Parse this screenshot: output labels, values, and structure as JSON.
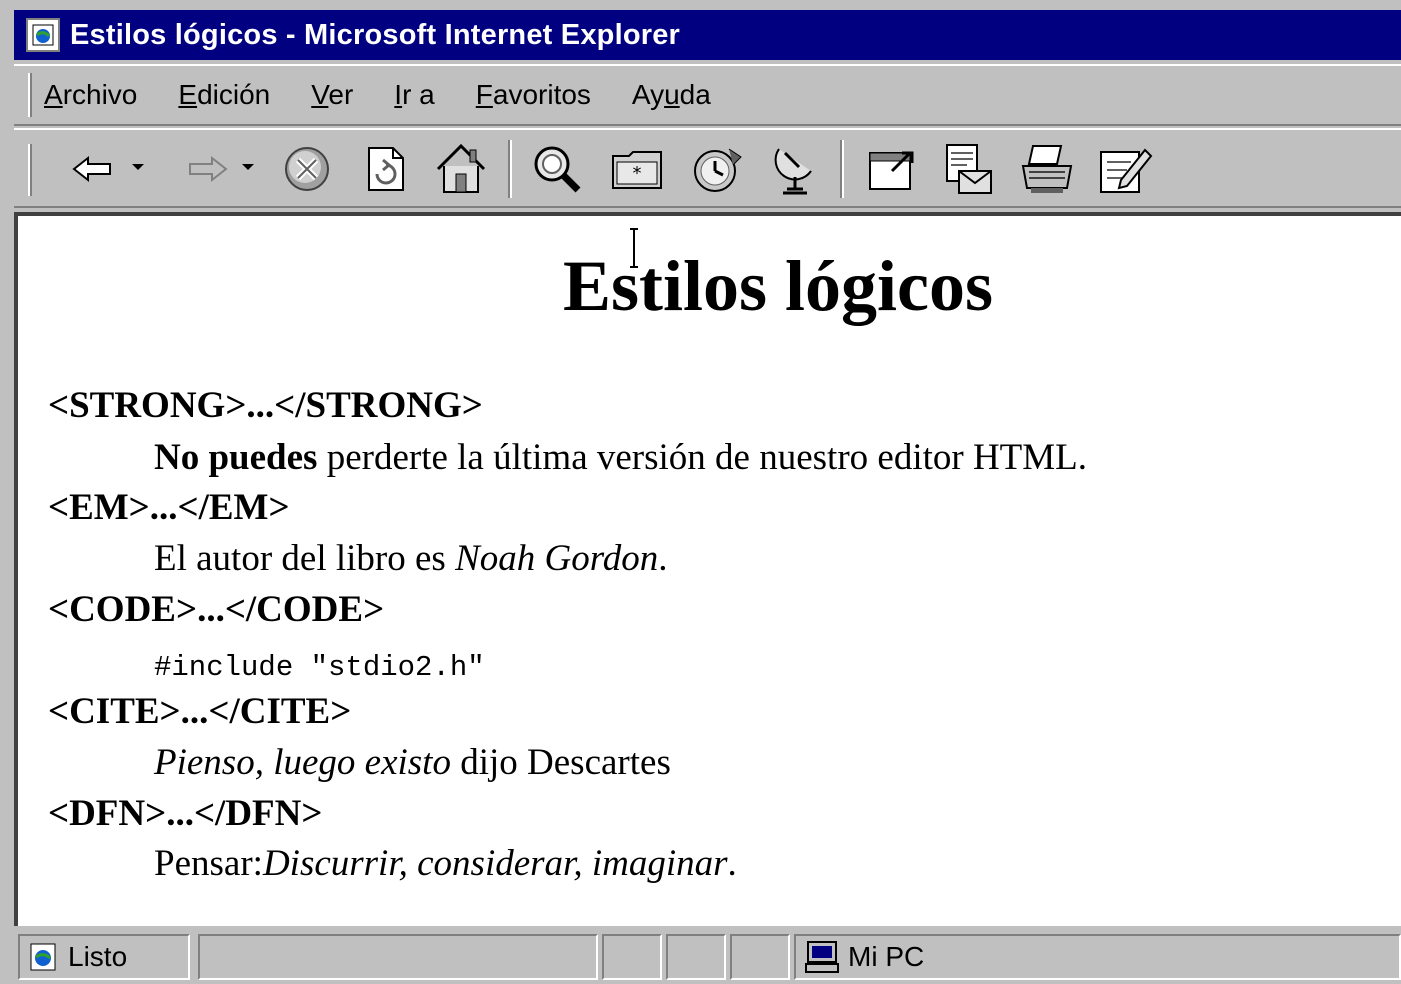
{
  "window": {
    "title": "Estilos lógicos - Microsoft Internet Explorer"
  },
  "menu": {
    "items": [
      {
        "label": "Archivo",
        "accel": "A"
      },
      {
        "label": "Edición",
        "accel": "E"
      },
      {
        "label": "Ver",
        "accel": "V"
      },
      {
        "label": "Ir a",
        "accel": "I"
      },
      {
        "label": "Favoritos",
        "accel": "F"
      },
      {
        "label": "Ayuda",
        "accel": "u"
      }
    ]
  },
  "toolbar": {
    "buttons": [
      "back-icon",
      "forward-icon",
      "stop-icon",
      "refresh-icon",
      "home-icon",
      "search-icon",
      "favorites-icon",
      "history-icon",
      "channels-icon",
      "fullscreen-icon",
      "mail-icon",
      "print-icon",
      "edit-icon"
    ]
  },
  "page": {
    "heading": "Estilos lógicos",
    "sections": [
      {
        "tag": "<STRONG>...</STRONG>",
        "strong": "No puedes",
        "text": " perderte la última versión de nuestro editor HTML."
      },
      {
        "tag": "<EM>...</EM>",
        "text": "El autor del libro es ",
        "em": "Noah Gordon",
        "tail": "."
      },
      {
        "tag": "<CODE>...</CODE>",
        "code": "#include \"stdio2.h\""
      },
      {
        "tag": "<CITE>...</CITE>",
        "cite": "Pienso, luego existo",
        "text": " dijo Descartes"
      },
      {
        "tag": "<DFN>...</DFN>",
        "text": "Pensar:",
        "dfn": "Discurrir, considerar, imaginar",
        "tail": "."
      }
    ]
  },
  "status": {
    "text": "Listo",
    "zone": "Mi PC"
  },
  "colors": {
    "titlebar": "#000080",
    "chrome": "#c0c0c0",
    "page_bg": "#ffffff"
  }
}
